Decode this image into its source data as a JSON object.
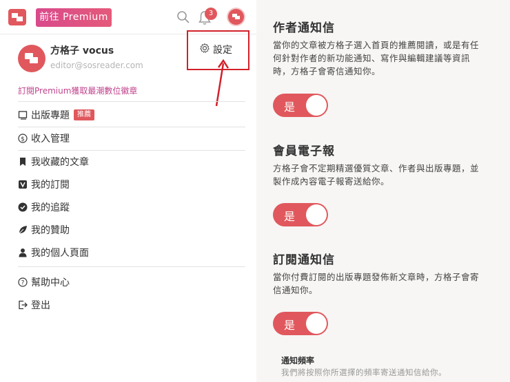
{
  "header": {
    "premium_button": "前往 Premium",
    "notification_count": "3"
  },
  "profile": {
    "name": "方格子 vocus",
    "email": "editor@sosreader.com"
  },
  "settings": {
    "label": "設定"
  },
  "promo": "訂閱Premium獲取最潮數位徽章",
  "menu": [
    {
      "label": "出版專題",
      "tag": "推薦",
      "icon": "book-icon"
    },
    {
      "label": "收入管理",
      "icon": "dollar-icon"
    },
    {
      "label": "我收藏的文章",
      "icon": "bookmark-icon"
    },
    {
      "label": "我的訂閱",
      "icon": "subscription-icon"
    },
    {
      "label": "我的追蹤",
      "icon": "check-circle-icon"
    },
    {
      "label": "我的贊助",
      "icon": "leaf-icon"
    },
    {
      "label": "我的個人頁面",
      "icon": "person-icon"
    },
    {
      "label": "幫助中心",
      "icon": "help-icon"
    },
    {
      "label": "登出",
      "icon": "logout-icon"
    }
  ],
  "notifications": [
    {
      "title": "作者通知信",
      "body": "當你的文章被方格子選入首頁的推薦閱讀，或是有任何針對作者的新功能通知、寫作與編輯建議等資訊時，方格子會寄信通知你。",
      "toggle": "是"
    },
    {
      "title": "會員電子報",
      "body": "方格子會不定期精選優質文章、作者與出版專題，並製作成內容電子報寄送給你。",
      "toggle": "是"
    },
    {
      "title": "訂閱通知信",
      "body": "當你付費訂閱的出版專題發佈新文章時，方格子會寄信通知你。",
      "toggle": "是"
    }
  ],
  "frequency": {
    "title": "通知頻率",
    "body": "我們將按照你所選擇的頻率寄送通知信給你。"
  },
  "colors": {
    "accent": "#e0585d",
    "premium_gradient_start": "#d94a8c",
    "highlight_box": "#d2202a",
    "promo_text": "#c0438c"
  }
}
